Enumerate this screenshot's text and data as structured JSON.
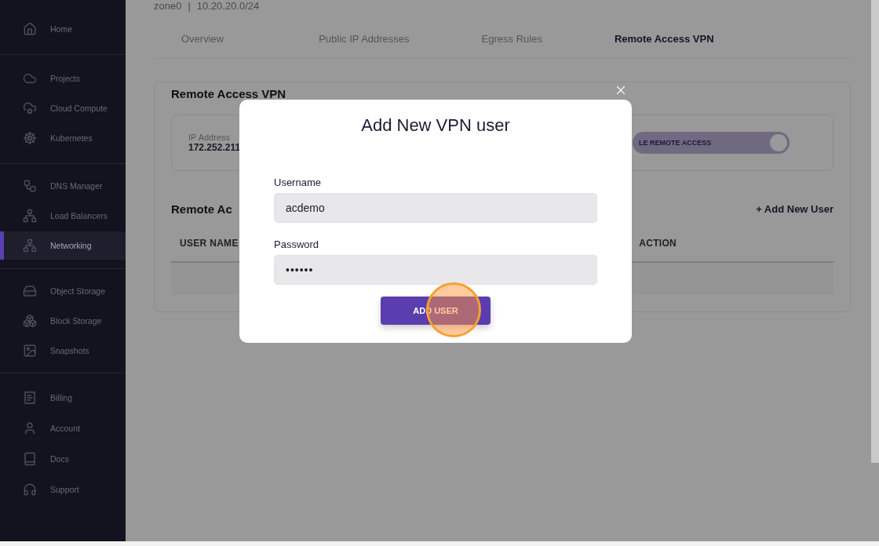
{
  "sidebar": {
    "groups": [
      {
        "items": [
          {
            "label": "Home",
            "selected": false
          }
        ]
      },
      {
        "items": [
          {
            "label": "Projects",
            "selected": false
          },
          {
            "label": "Cloud Compute",
            "selected": false
          },
          {
            "label": "Kubernetes",
            "selected": false
          }
        ]
      },
      {
        "items": [
          {
            "label": "DNS Manager",
            "selected": false
          },
          {
            "label": "Load Balancers",
            "selected": false
          },
          {
            "label": "Networking",
            "selected": true
          }
        ]
      },
      {
        "items": [
          {
            "label": "Object Storage",
            "selected": false
          },
          {
            "label": "Block Storage",
            "selected": false
          },
          {
            "label": "Snapshots",
            "selected": false
          }
        ]
      },
      {
        "items": [
          {
            "label": "Billing",
            "selected": false
          },
          {
            "label": "Account",
            "selected": false
          },
          {
            "label": "Docs",
            "selected": false
          },
          {
            "label": "Support",
            "selected": false
          }
        ]
      }
    ]
  },
  "header": {
    "zone": "zone0",
    "separator": "|",
    "subnet": "10.20.20.0/24"
  },
  "tabs": [
    {
      "label": "Overview",
      "selected": false
    },
    {
      "label": "Public IP Addresses",
      "selected": false
    },
    {
      "label": "Egress Rules",
      "selected": false
    },
    {
      "label": "Remote Access VPN",
      "selected": true
    }
  ],
  "vpn_card": {
    "title": "Remote Access VPN",
    "ip_label": "IP Address",
    "ip_value": "172.252.211",
    "toggle": {
      "label": "LE REMOTE ACCESS",
      "on": true
    }
  },
  "users_section": {
    "title": "Remote Ac",
    "add_link": "+ Add New User",
    "columns": [
      "USER NAME",
      "ACTION"
    ]
  },
  "modal": {
    "title": "Add New VPN user",
    "fields": [
      {
        "label": "Username",
        "value": "acdemo",
        "kind": "text"
      },
      {
        "label": "Password",
        "value": "••••••",
        "kind": "password"
      }
    ],
    "submit": "ADD USER"
  }
}
